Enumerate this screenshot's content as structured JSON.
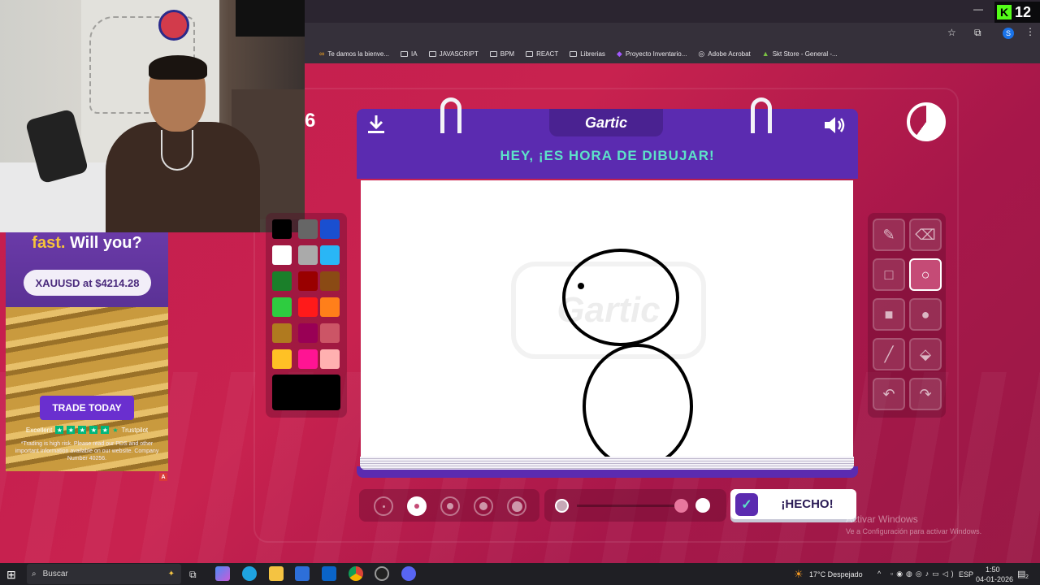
{
  "browser": {
    "bookmarks": [
      "Te damos la bienve...",
      "IA",
      "JAVASCRIPT",
      "BPM",
      "REACT",
      "Librerias",
      "Proyecto Inventario...",
      "Adobe Acrobat",
      "Skt Store - General -..."
    ],
    "kick_viewers": "12"
  },
  "stream": {
    "ad": {
      "headline_a": "fast.",
      "headline_b": "Will you?",
      "price_pill": "XAUUSD at $4214.28",
      "cta": "TRADE TODAY",
      "rating_label": "Excellent",
      "rating_source": "Trustpilot",
      "disclaimer": "*Trading is high risk. Please read our PDS and other important information available on our website. Company Number 40256.",
      "flag": "A"
    }
  },
  "game": {
    "round_partial": "6",
    "logo": "Gartic",
    "title": "HEY, ¡ES HORA DE DIBUJAR!",
    "watermark": "Gartic",
    "done_label": "¡HECHO!",
    "palette_colors": [
      "#000000",
      "#666666",
      "#1a4fd0",
      "#ffffff",
      "#aaaaaa",
      "#29b6f6",
      "#1b7f2a",
      "#990000",
      "#8a4a14",
      "#2ecc40",
      "#ff1a1a",
      "#ff7f1a",
      "#b07a1f",
      "#990055",
      "#cc5566",
      "#ffc125",
      "#ff1493",
      "#ffb0b0"
    ],
    "selected_color": "#000000",
    "tools": [
      "pencil-icon",
      "eraser-icon",
      "rect-outline-icon",
      "ellipse-outline-icon",
      "rect-fill-icon",
      "ellipse-fill-icon",
      "line-icon",
      "bucket-icon",
      "undo-icon",
      "redo-icon"
    ],
    "active_tool": "ellipse-outline-icon",
    "brush_sizes": 5,
    "active_brush_size": 2
  },
  "windows": {
    "activate_title": "Activar Windows",
    "activate_sub": "Ve a Configuración para activar Windows.",
    "search_placeholder": "Buscar",
    "weather": "17°C  Despejado",
    "lang": "ESP",
    "time": "1:50",
    "date": "04-01-2026",
    "notif_count": "2"
  }
}
